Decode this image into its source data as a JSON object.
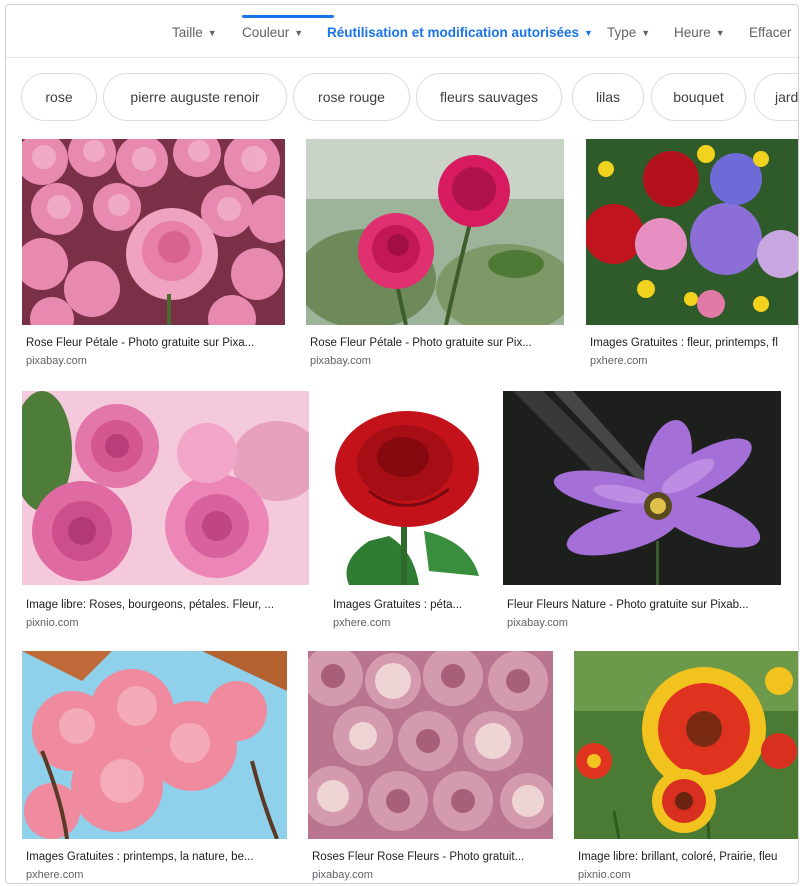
{
  "toolbar": {
    "size": "Taille",
    "color": "Couleur",
    "usage_rights": "Réutilisation et modification autorisées",
    "type": "Type",
    "time": "Heure",
    "clear": "Effacer",
    "accent_color": "#1a73e8"
  },
  "chips": [
    "rose",
    "pierre auguste renoir",
    "rose rouge",
    "fleurs sauvages",
    "lilas",
    "bouquet",
    "jard"
  ],
  "results": [
    {
      "title": "Rose Fleur Pétale - Photo gratuite sur Pixa...",
      "source": "pixabay.com"
    },
    {
      "title": "Rose Fleur Pétale - Photo gratuite sur Pix...",
      "source": "pixabay.com"
    },
    {
      "title": "Images Gratuites : fleur, printemps, fl",
      "source": "pxhere.com"
    },
    {
      "title": "Image libre: Roses, bourgeons, pétales. Fleur, ...",
      "source": "pixnio.com"
    },
    {
      "title": "Images Gratuites : péta...",
      "source": "pxhere.com"
    },
    {
      "title": "Fleur Fleurs Nature - Photo gratuite sur Pixab...",
      "source": "pixabay.com"
    },
    {
      "title": "Images Gratuites : printemps, la nature, be...",
      "source": "pxhere.com"
    },
    {
      "title": "Roses Fleur Rose Fleurs - Photo gratuit...",
      "source": "pixabay.com"
    },
    {
      "title": "Image libre: brillant, coloré, Prairie, fleu",
      "source": "pixnio.com"
    }
  ]
}
